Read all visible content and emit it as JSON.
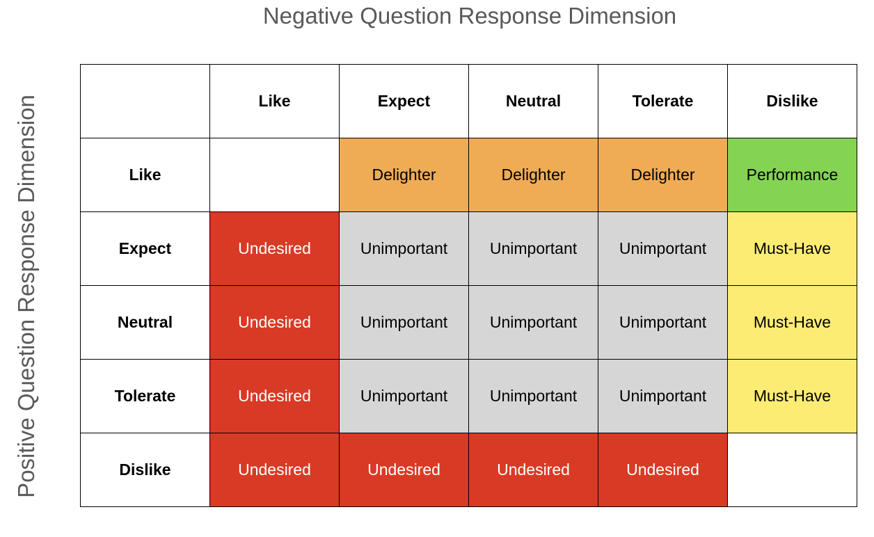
{
  "title": "Negative Question Response Dimension",
  "y_axis_label": "Positive Question Response Dimension",
  "column_headers": [
    "Like",
    "Expect",
    "Neutral",
    "Tolerate",
    "Dislike"
  ],
  "row_headers": [
    "Like",
    "Expect",
    "Neutral",
    "Tolerate",
    "Dislike"
  ],
  "category_colors": {
    "Delighter": {
      "bg": "#f0ab55",
      "fg": "#000000"
    },
    "Performance": {
      "bg": "#84d353",
      "fg": "#000000"
    },
    "Undesired": {
      "bg": "#d93a25",
      "fg": "#ffffff"
    },
    "Unimportant": {
      "bg": "#d6d6d6",
      "fg": "#000000"
    },
    "Must-Have": {
      "bg": "#fcec73",
      "fg": "#000000"
    },
    "": {
      "bg": "#ffffff",
      "fg": "#000000"
    }
  },
  "cells": [
    [
      "",
      "Delighter",
      "Delighter",
      "Delighter",
      "Performance"
    ],
    [
      "Undesired",
      "Unimportant",
      "Unimportant",
      "Unimportant",
      "Must-Have"
    ],
    [
      "Undesired",
      "Unimportant",
      "Unimportant",
      "Unimportant",
      "Must-Have"
    ],
    [
      "Undesired",
      "Unimportant",
      "Unimportant",
      "Unimportant",
      "Must-Have"
    ],
    [
      "Undesired",
      "Undesired",
      "Undesired",
      "Undesired",
      ""
    ]
  ]
}
